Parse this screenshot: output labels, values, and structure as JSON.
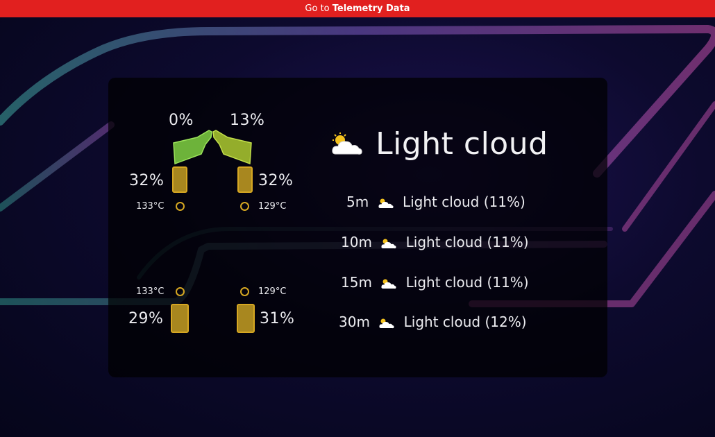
{
  "topbar": {
    "prefix": "Go to",
    "link": "Telemetry Data"
  },
  "colors": {
    "topbar": "#e1201f",
    "tyre_fill": "#a8871f",
    "tyre_border": "#d6a722",
    "wing_left": "#6db33a",
    "wing_right": "#94ad2b"
  },
  "car": {
    "front_wing": {
      "left_damage": "0%",
      "right_damage": "13%"
    },
    "tyres": {
      "front_left": {
        "wear": "32%",
        "temp": "133°C"
      },
      "front_right": {
        "wear": "32%",
        "temp": "129°C"
      },
      "rear_left": {
        "wear": "29%",
        "temp": "133°C"
      },
      "rear_right": {
        "wear": "31%",
        "temp": "129°C"
      }
    }
  },
  "weather": {
    "current": {
      "icon": "partly-cloudy-icon",
      "label": "Light cloud"
    },
    "forecast": [
      {
        "time": "5m",
        "icon": "partly-cloudy-icon",
        "label": "Light cloud (11%)"
      },
      {
        "time": "10m",
        "icon": "partly-cloudy-icon",
        "label": "Light cloud (11%)"
      },
      {
        "time": "15m",
        "icon": "partly-cloudy-icon",
        "label": "Light cloud (11%)"
      },
      {
        "time": "30m",
        "icon": "partly-cloudy-icon",
        "label": "Light cloud (12%)"
      }
    ]
  }
}
